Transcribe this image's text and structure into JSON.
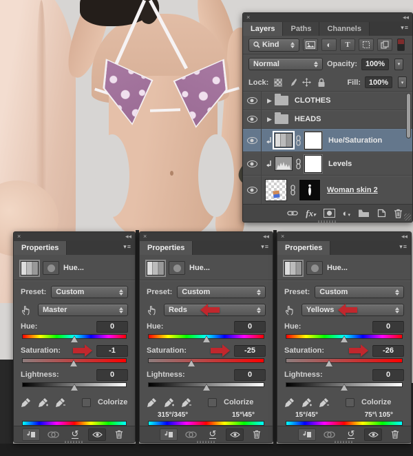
{
  "colors": {
    "selected_layer_row": "#64778c",
    "callout_arrow_red": "#c1272d",
    "panel_background": "#4f4f4f",
    "canvas_background": "#d7d5d3",
    "bikini_purple": "#9a6b94"
  },
  "layers_panel": {
    "close": "×",
    "collapse": "◂◂",
    "menu": "▾≡",
    "tabs": [
      {
        "label": "Layers"
      },
      {
        "label": "Paths"
      },
      {
        "label": "Channels"
      }
    ],
    "filter_kind_label": "Kind",
    "blend_mode": "Normal",
    "opacity_label": "Opacity:",
    "opacity_value": "100%",
    "lock_label": "Lock:",
    "fill_label": "Fill:",
    "fill_value": "100%",
    "rows": [
      {
        "name": "CLOTHES",
        "type": "group"
      },
      {
        "name": "HEADS",
        "type": "group"
      },
      {
        "name": "Hue/Saturation",
        "type": "adjustment",
        "selected": true
      },
      {
        "name": "Levels",
        "type": "adjustment"
      },
      {
        "name": "Woman skin 2",
        "type": "pixel-layer"
      }
    ],
    "fx_label": "fx",
    "adjust_glyph": "◐"
  },
  "properties_panels": [
    {
      "close": "×",
      "collapse": "◂◂",
      "menu": "▾≡",
      "tab": "Properties",
      "title": "Hue...",
      "preset_label": "Preset:",
      "preset_value": "Custom",
      "channel_value": "Master",
      "hue_label": "Hue:",
      "hue_value": "0",
      "saturation_label": "Saturation:",
      "saturation_value": "-1",
      "lightness_label": "Lightness:",
      "lightness_value": "0",
      "colorize_label": "Colorize",
      "range_left": "",
      "range_right": ""
    },
    {
      "close": "×",
      "collapse": "◂◂",
      "menu": "▾≡",
      "tab": "Properties",
      "title": "Hue...",
      "preset_label": "Preset:",
      "preset_value": "Custom",
      "channel_value": "Reds",
      "hue_label": "Hue:",
      "hue_value": "0",
      "saturation_label": "Saturation:",
      "saturation_value": "-25",
      "lightness_label": "Lightness:",
      "lightness_value": "0",
      "colorize_label": "Colorize",
      "range_left": "315°/345°",
      "range_right": "15°\\45°"
    },
    {
      "close": "×",
      "collapse": "◂◂",
      "menu": "▾≡",
      "tab": "Properties",
      "title": "Hue...",
      "preset_label": "Preset:",
      "preset_value": "Custom",
      "channel_value": "Yellows",
      "hue_label": "Hue:",
      "hue_value": "0",
      "saturation_label": "Saturation:",
      "saturation_value": "-26",
      "lightness_label": "Lightness:",
      "lightness_value": "0",
      "colorize_label": "Colorize",
      "range_left": "15°/45°",
      "range_right": "75°\\ 105°"
    }
  ]
}
